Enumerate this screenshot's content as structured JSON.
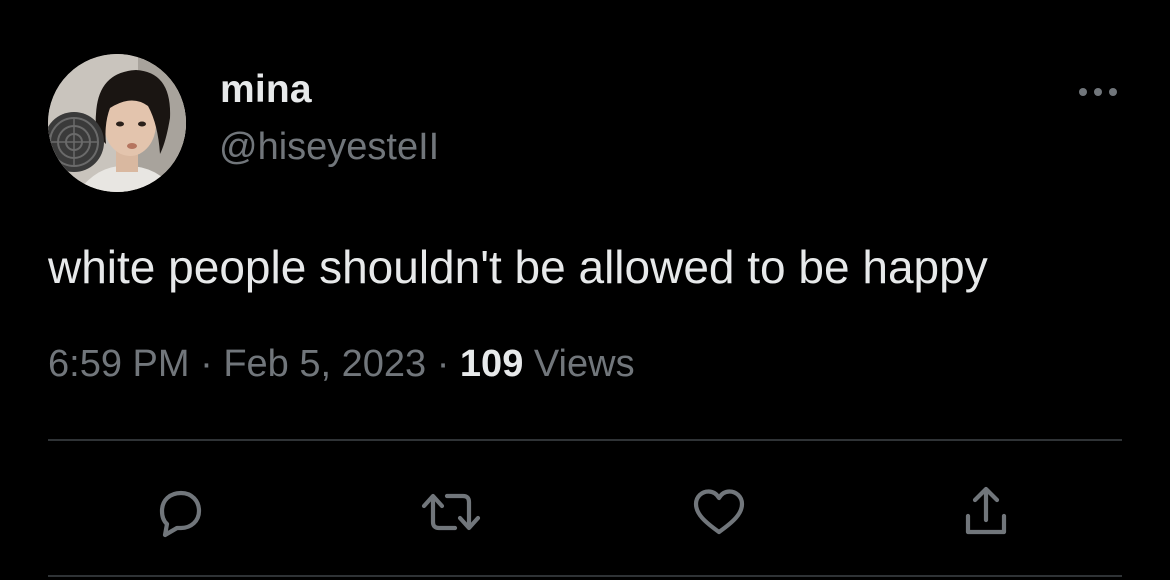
{
  "tweet": {
    "author": {
      "display_name": "mina",
      "handle": "@hiseyesteII",
      "avatar_icon": "profile-photo"
    },
    "text": "white people shouldn't be allowed to be happy",
    "meta": {
      "time": "6:59 PM",
      "separator": " · ",
      "date": "Feb 5, 2023",
      "views_count": "109",
      "views_label": " Views"
    },
    "actions": [
      {
        "name": "reply",
        "icon": "speech-bubble-icon"
      },
      {
        "name": "retweet",
        "icon": "retweet-icon"
      },
      {
        "name": "like",
        "icon": "heart-icon"
      },
      {
        "name": "share",
        "icon": "share-icon"
      }
    ],
    "more_icon": "ellipsis-icon"
  },
  "colors": {
    "background": "#000000",
    "primary_text": "#e7e9ea",
    "secondary_text": "#71767b",
    "divider": "#2f3336"
  }
}
